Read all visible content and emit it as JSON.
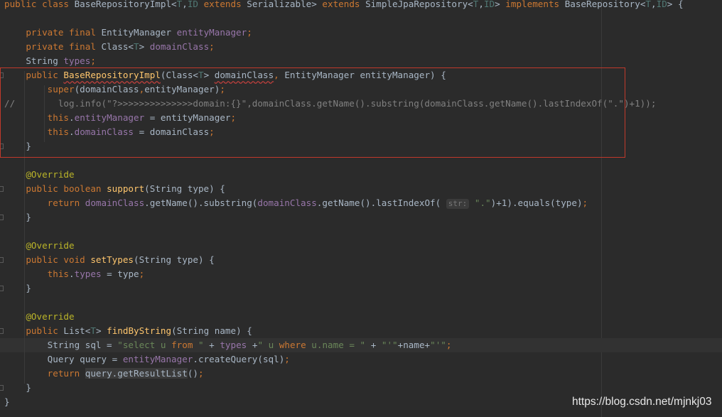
{
  "editor": {
    "lines": [
      [
        {
          "t": "public class ",
          "c": "k"
        },
        {
          "t": "BaseRepositoryImpl<"
        },
        {
          "t": "T",
          "c": "tp"
        },
        {
          "t": ","
        },
        {
          "t": "ID",
          "c": "tp"
        },
        {
          "t": " "
        },
        {
          "t": "extends ",
          "c": "k"
        },
        {
          "t": "Serializable> "
        },
        {
          "t": "extends ",
          "c": "k"
        },
        {
          "t": "SimpleJpaRepository<"
        },
        {
          "t": "T",
          "c": "tp"
        },
        {
          "t": ","
        },
        {
          "t": "ID",
          "c": "tp"
        },
        {
          "t": "> "
        },
        {
          "t": "implements ",
          "c": "k"
        },
        {
          "t": "BaseRepository<"
        },
        {
          "t": "T",
          "c": "tp"
        },
        {
          "t": ","
        },
        {
          "t": "ID",
          "c": "tp"
        },
        {
          "t": "> {"
        }
      ],
      [],
      [
        {
          "t": "    "
        },
        {
          "t": "private final ",
          "c": "k"
        },
        {
          "t": "EntityManager "
        },
        {
          "t": "entityManager",
          "c": "f"
        },
        {
          "t": ";",
          "c": "k"
        }
      ],
      [
        {
          "t": "    "
        },
        {
          "t": "private final ",
          "c": "k"
        },
        {
          "t": "Class<"
        },
        {
          "t": "T",
          "c": "tp"
        },
        {
          "t": "> "
        },
        {
          "t": "domainClass",
          "c": "f"
        },
        {
          "t": ";",
          "c": "k"
        }
      ],
      [
        {
          "t": "    String "
        },
        {
          "t": "types",
          "c": "f"
        },
        {
          "t": ";",
          "c": "k"
        }
      ],
      [
        {
          "t": "    "
        },
        {
          "t": "public ",
          "c": "k"
        },
        {
          "t": "BaseRepositoryImpl",
          "c": "m sq"
        },
        {
          "t": "(Class<"
        },
        {
          "t": "T",
          "c": "tp"
        },
        {
          "t": "> "
        },
        {
          "t": "domainClass",
          "c": "sq"
        },
        {
          "t": ", ",
          "c": "k"
        },
        {
          "t": "EntityManager entityManager) {"
        }
      ],
      [
        {
          "t": "        "
        },
        {
          "t": "super",
          "c": "k"
        },
        {
          "t": "(domainClass"
        },
        {
          "t": ",",
          "c": "k"
        },
        {
          "t": "entityManager)"
        },
        {
          "t": ";",
          "c": "k"
        }
      ],
      [
        {
          "t": "//        log.info(\"?>>>>>>>>>>>>>>domain:{}\",domainClass.getName().substring(domainClass.getName().lastIndexOf(\".\")+1));",
          "c": "cm"
        }
      ],
      [
        {
          "t": "        "
        },
        {
          "t": "this",
          "c": "k"
        },
        {
          "t": "."
        },
        {
          "t": "entityManager",
          "c": "f"
        },
        {
          "t": " = entityManager"
        },
        {
          "t": ";",
          "c": "k"
        }
      ],
      [
        {
          "t": "        "
        },
        {
          "t": "this",
          "c": "k"
        },
        {
          "t": "."
        },
        {
          "t": "domainClass",
          "c": "f"
        },
        {
          "t": " = domainClass"
        },
        {
          "t": ";",
          "c": "k"
        }
      ],
      [
        {
          "t": "    }"
        }
      ],
      [],
      [
        {
          "t": "    "
        },
        {
          "t": "@Override",
          "c": "an"
        }
      ],
      [
        {
          "t": "    "
        },
        {
          "t": "public boolean ",
          "c": "k"
        },
        {
          "t": "support",
          "c": "m"
        },
        {
          "t": "(String type) {"
        }
      ],
      [
        {
          "t": "        "
        },
        {
          "t": "return ",
          "c": "k"
        },
        {
          "t": "domainClass",
          "c": "f"
        },
        {
          "t": ".getName().substring("
        },
        {
          "t": "domainClass",
          "c": "f"
        },
        {
          "t": ".getName().lastIndexOf( "
        },
        {
          "t": "str:",
          "c": "hint"
        },
        {
          "t": " "
        },
        {
          "t": "\".\"",
          "c": "s"
        },
        {
          "t": ")+"
        },
        {
          "t": "1",
          "c": "num"
        },
        {
          "t": ").equals(type)"
        },
        {
          "t": ";",
          "c": "k"
        }
      ],
      [
        {
          "t": "    }"
        }
      ],
      [],
      [
        {
          "t": "    "
        },
        {
          "t": "@Override",
          "c": "an"
        }
      ],
      [
        {
          "t": "    "
        },
        {
          "t": "public void ",
          "c": "k"
        },
        {
          "t": "setTypes",
          "c": "m"
        },
        {
          "t": "(String type) {"
        }
      ],
      [
        {
          "t": "        "
        },
        {
          "t": "this",
          "c": "k"
        },
        {
          "t": "."
        },
        {
          "t": "types",
          "c": "f"
        },
        {
          "t": " = type"
        },
        {
          "t": ";",
          "c": "k"
        }
      ],
      [
        {
          "t": "    }"
        }
      ],
      [],
      [
        {
          "t": "    "
        },
        {
          "t": "@Override",
          "c": "an"
        }
      ],
      [
        {
          "t": "    "
        },
        {
          "t": "public ",
          "c": "k"
        },
        {
          "t": "List<"
        },
        {
          "t": "T",
          "c": "tp"
        },
        {
          "t": "> "
        },
        {
          "t": "findByString",
          "c": "m"
        },
        {
          "t": "(String name) {"
        }
      ],
      [
        {
          "t": "        String sql = "
        },
        {
          "t": "\"select ",
          "c": "s"
        },
        {
          "t": "u ",
          "c": "s2"
        },
        {
          "t": "from ",
          "c": "k"
        },
        {
          "t": "\"",
          "c": "s"
        },
        {
          "t": " + "
        },
        {
          "t": "types",
          "c": "f"
        },
        {
          "t": " +"
        },
        {
          "t": "\" ",
          "c": "s"
        },
        {
          "t": "u ",
          "c": "s2"
        },
        {
          "t": "where ",
          "c": "k"
        },
        {
          "t": "u.name = ",
          "c": "s2"
        },
        {
          "t": "\"",
          "c": "s"
        },
        {
          "t": " + "
        },
        {
          "t": "\"'\"",
          "c": "s"
        },
        {
          "t": "+name+"
        },
        {
          "t": "\"'\"",
          "c": "s"
        },
        {
          "t": ";",
          "c": "k"
        }
      ],
      [
        {
          "t": "        Query query = "
        },
        {
          "t": "entityManager",
          "c": "f"
        },
        {
          "t": ".createQuery(sql)"
        },
        {
          "t": ";",
          "c": "k"
        }
      ],
      [
        {
          "t": "        "
        },
        {
          "t": "return ",
          "c": "k"
        },
        {
          "t": "query.getResultList",
          "c": "hl"
        },
        {
          "t": "()"
        },
        {
          "t": ";",
          "c": "k"
        }
      ],
      [
        {
          "t": "    }"
        }
      ],
      [
        {
          "t": "}"
        }
      ]
    ]
  },
  "watermark": "https://blog.csdn.net/mjnkj03",
  "colors": {
    "background": "#2b2b2b",
    "keyword": "#cc7832",
    "field": "#9876aa",
    "string": "#6a8759",
    "method": "#ffc66d",
    "annotation": "#bbb529",
    "comment": "#808080",
    "selection_border": "#c0392b"
  }
}
